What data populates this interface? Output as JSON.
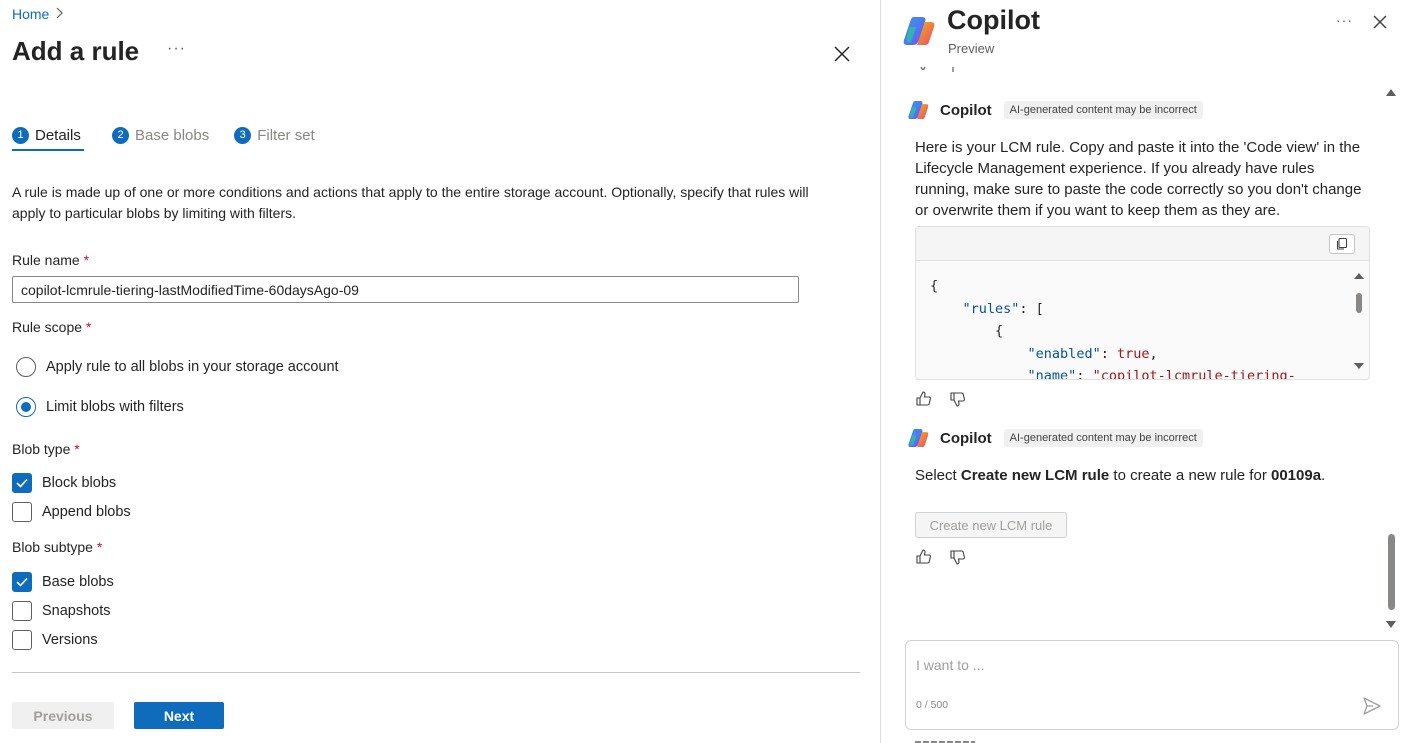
{
  "breadcrumb": {
    "home": "Home"
  },
  "page": {
    "title": "Add a rule",
    "more": "···"
  },
  "steps": [
    {
      "num": "1",
      "label": "Details"
    },
    {
      "num": "2",
      "label": "Base blobs"
    },
    {
      "num": "3",
      "label": "Filter set"
    }
  ],
  "description": "A rule is made up of one or more conditions and actions that apply to the entire storage account. Optionally, specify that rules will apply to particular blobs by limiting with filters.",
  "form": {
    "rule_name_label": "Rule name",
    "rule_name_value": "copilot-lcmrule-tiering-lastModifiedTime-60daysAgo-09",
    "required": "*",
    "rule_scope_label": "Rule scope",
    "scope_all": "Apply rule to all blobs in your storage account",
    "scope_filter": "Limit blobs with filters",
    "blob_type_label": "Blob type",
    "block_blobs": "Block blobs",
    "append_blobs": "Append blobs",
    "blob_subtype_label": "Blob subtype",
    "base_blobs": "Base blobs",
    "snapshots": "Snapshots",
    "versions": "Versions"
  },
  "footer": {
    "previous": "Previous",
    "next": "Next"
  },
  "copilot": {
    "title": "Copilot",
    "subtitle": "Preview",
    "more": "···",
    "msg1": {
      "author": "Copilot",
      "badge": "AI-generated content may be incorrect",
      "text": "Here is your LCM rule. Copy and paste it into the 'Code view' in the Lifecycle Management experience. If you already have rules running, make sure to paste the code correctly so you don't change or overwrite them if you want to keep them as they are.",
      "code": {
        "l1": "{",
        "l2_key": "\"rules\"",
        "l2_rest": ": [",
        "l3": "{",
        "l4_key": "\"enabled\"",
        "l4_sep": ": ",
        "l4_val": "true",
        "l4_end": ",",
        "l5_key": "\"name\"",
        "l5_sep": ": ",
        "l5_val": "\"copilot-lcmrule-tiering-"
      }
    },
    "msg2": {
      "author": "Copilot",
      "badge": "AI-generated content may be incorrect",
      "text_pre": "Select ",
      "text_bold": "Create new LCM rule",
      "text_mid": " to create a new rule for ",
      "text_bold2": "00109a",
      "text_end": ".",
      "button": "Create new LCM rule"
    },
    "input": {
      "placeholder": "I want to ...",
      "count": "0 / 500"
    }
  }
}
